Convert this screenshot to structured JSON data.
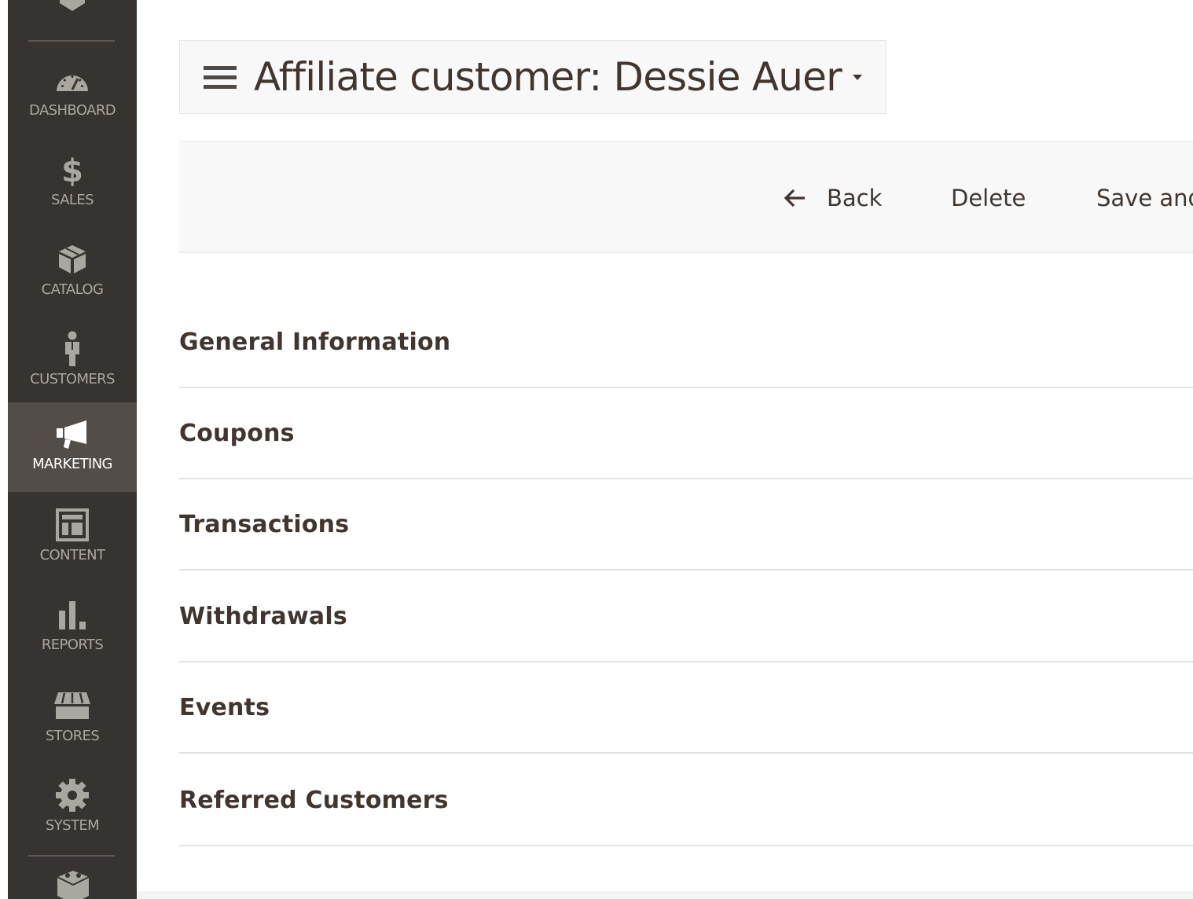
{
  "sidebar": {
    "items": [
      {
        "label": "DASHBOARD",
        "icon": "dashboard-icon"
      },
      {
        "label": "SALES",
        "icon": "dollar-icon"
      },
      {
        "label": "CATALOG",
        "icon": "box-icon"
      },
      {
        "label": "CUSTOMERS",
        "icon": "person-icon"
      },
      {
        "label": "MARKETING",
        "icon": "megaphone-icon",
        "active": true
      },
      {
        "label": "CONTENT",
        "icon": "layout-icon"
      },
      {
        "label": "REPORTS",
        "icon": "bar-chart-icon"
      },
      {
        "label": "STORES",
        "icon": "storefront-icon"
      },
      {
        "label": "SYSTEM",
        "icon": "gear-icon"
      }
    ]
  },
  "header": {
    "title": "Affiliate customer: Dessie Auer"
  },
  "actions": {
    "back": "Back",
    "delete": "Delete",
    "save_continue": "Save and"
  },
  "sections": [
    "General Information",
    "Coupons",
    "Transactions",
    "Withdrawals",
    "Events",
    "Referred Customers"
  ],
  "colors": {
    "sidebar_bg": "#373330",
    "sidebar_active": "#524d49",
    "text": "#41362f"
  }
}
